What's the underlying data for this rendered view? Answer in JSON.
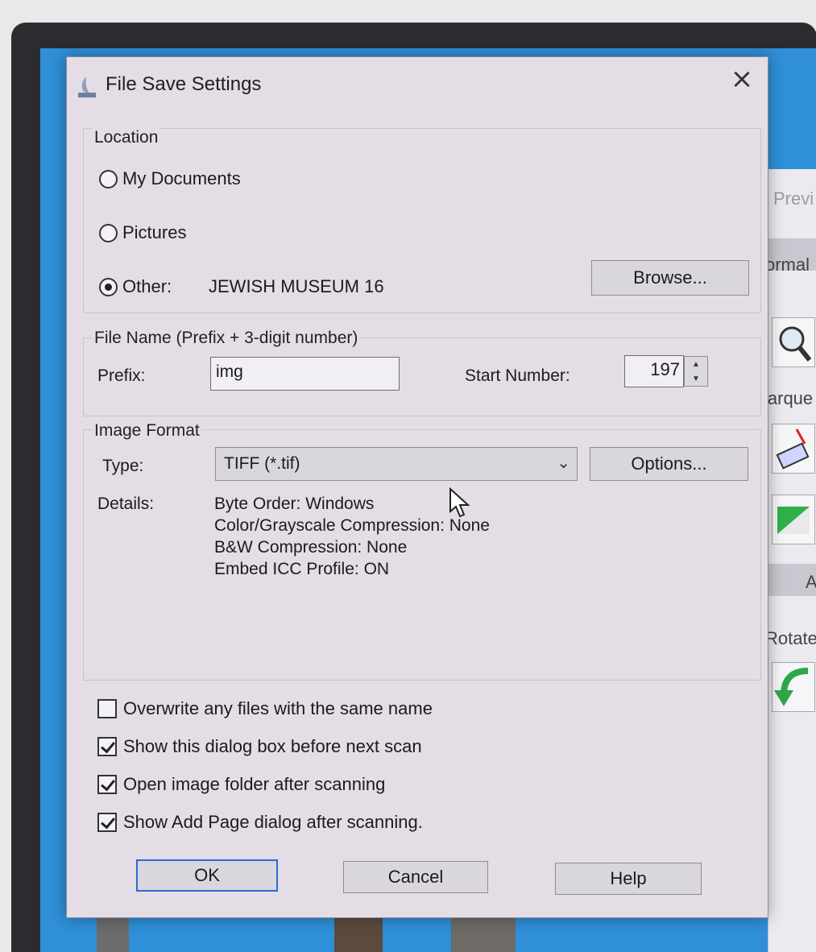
{
  "dialog": {
    "title": "File Save Settings",
    "close_glyph": "×"
  },
  "location": {
    "label": "Location",
    "options": [
      {
        "label": "My Documents",
        "checked": false
      },
      {
        "label": "Pictures",
        "checked": false
      },
      {
        "label": "Other:",
        "checked": true
      }
    ],
    "other_value": "JEWISH MUSEUM 16",
    "browse_label": "Browse..."
  },
  "file_name": {
    "label": "File Name (Prefix + 3-digit number)",
    "prefix_label": "Prefix:",
    "prefix_value": "img",
    "start_number_label": "Start Number:",
    "start_number_value": "197"
  },
  "image_format": {
    "label": "Image Format",
    "type_label": "Type:",
    "type_value": "TIFF (*.tif)",
    "options_label": "Options...",
    "details_label": "Details:",
    "details": [
      "Byte Order: Windows",
      "Color/Grayscale Compression: None",
      "B&W Compression: None",
      "Embed ICC Profile: ON"
    ]
  },
  "checkboxes": [
    {
      "label": "Overwrite any files with the same name",
      "checked": false
    },
    {
      "label": "Show this dialog box before next scan",
      "checked": true
    },
    {
      "label": "Open image folder after scanning",
      "checked": true
    },
    {
      "label": "Show Add Page dialog after scanning.",
      "checked": true
    }
  ],
  "buttons": {
    "ok": "OK",
    "cancel": "Cancel",
    "help": "Help"
  },
  "background_app": {
    "labels": [
      "Previ",
      "ormal",
      "larque",
      "A",
      "Rotate"
    ]
  },
  "colors": {
    "dialog_bg": "#e4dde6",
    "desktop": "#2f8fd8",
    "default_button_border": "#2a6ad1"
  }
}
